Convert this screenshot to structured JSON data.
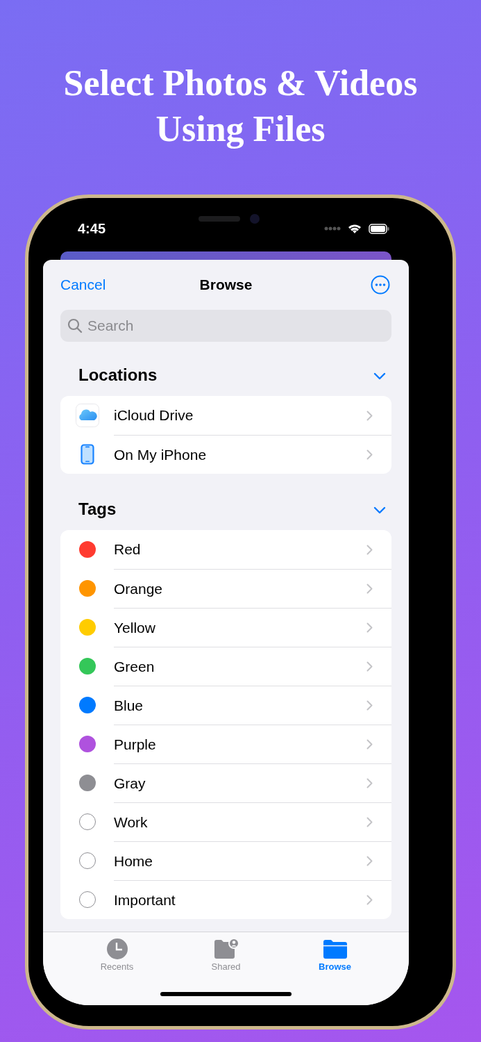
{
  "headline": {
    "lines": [
      "Select Photos & Videos",
      "Using Files"
    ]
  },
  "status_bar": {
    "time": "4:45"
  },
  "nav": {
    "cancel": "Cancel",
    "title": "Browse"
  },
  "search": {
    "placeholder": "Search"
  },
  "sections": [
    {
      "title": "Locations",
      "expanded": true,
      "items": [
        {
          "label": "iCloud Drive",
          "kind": "cloud"
        },
        {
          "label": "On My iPhone",
          "kind": "phone"
        }
      ]
    },
    {
      "title": "Tags",
      "expanded": true,
      "items": [
        {
          "label": "Red",
          "kind": "tag",
          "color": "#ff3b30"
        },
        {
          "label": "Orange",
          "kind": "tag",
          "color": "#ff9500"
        },
        {
          "label": "Yellow",
          "kind": "tag",
          "color": "#ffcc00"
        },
        {
          "label": "Green",
          "kind": "tag",
          "color": "#34c759"
        },
        {
          "label": "Blue",
          "kind": "tag",
          "color": "#007aff"
        },
        {
          "label": "Purple",
          "kind": "tag",
          "color": "#af52de"
        },
        {
          "label": "Gray",
          "kind": "tag",
          "color": "#8e8e93"
        },
        {
          "label": "Work",
          "kind": "tag"
        },
        {
          "label": "Home",
          "kind": "tag"
        },
        {
          "label": "Important",
          "kind": "tag"
        }
      ]
    }
  ],
  "tabs": [
    {
      "label": "Recents",
      "kind": "clock",
      "selected": false
    },
    {
      "label": "Shared",
      "kind": "shared",
      "selected": false
    },
    {
      "label": "Browse",
      "kind": "folder",
      "selected": true
    }
  ]
}
